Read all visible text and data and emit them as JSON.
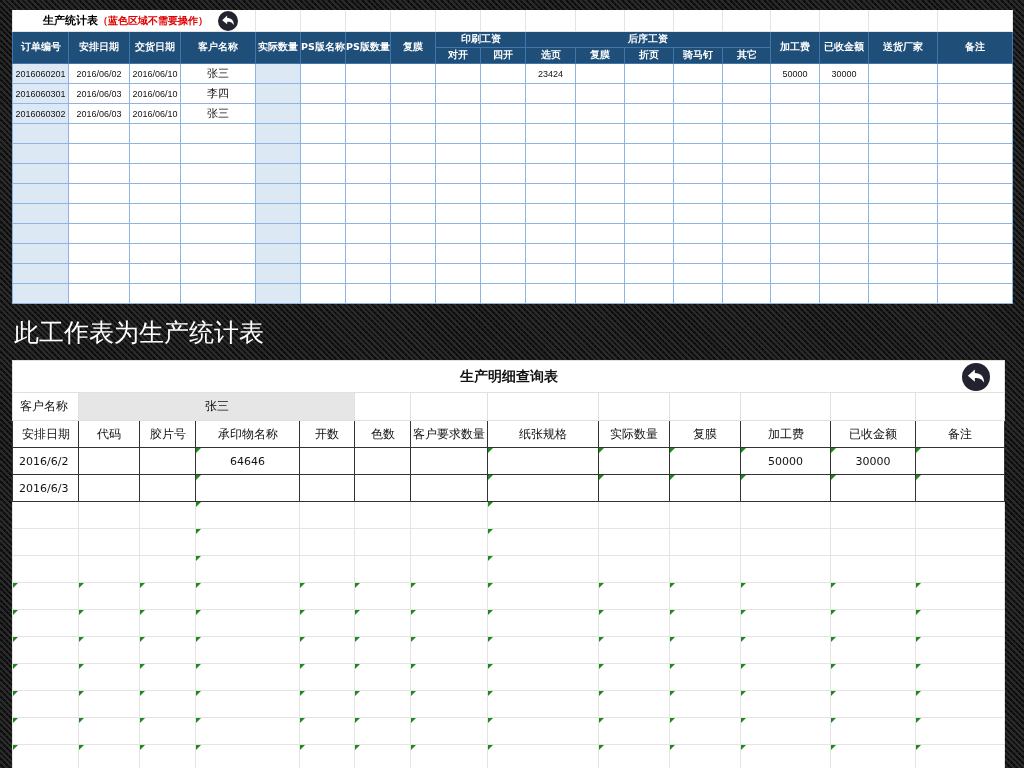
{
  "stats_sheet": {
    "title": "生产统计表",
    "note": "（蓝色区域不需要操作）",
    "headers": [
      {
        "label": "订单编号",
        "shaded": true
      },
      {
        "label": "安排日期",
        "shaded": false
      },
      {
        "label": "交货日期",
        "shaded": false
      },
      {
        "label": "客户名称",
        "shaded": false
      },
      {
        "label": "实际数量",
        "shaded": true
      },
      {
        "label": "PS版名称",
        "shaded": false
      },
      {
        "label": "PS版数量",
        "shaded": false
      },
      {
        "label": "复膜",
        "shaded": false
      },
      {
        "label": "印刷工资",
        "children": [
          {
            "label": "对开",
            "shaded": false
          },
          {
            "label": "四开",
            "shaded": false
          }
        ]
      },
      {
        "label": "后序工资",
        "children": [
          {
            "label": "选页",
            "shaded": false
          },
          {
            "label": "复膜",
            "shaded": false
          },
          {
            "label": "折页",
            "shaded": false
          },
          {
            "label": "骑马钉",
            "shaded": false
          },
          {
            "label": "其它",
            "shaded": false
          }
        ]
      },
      {
        "label": "加工费",
        "shaded": false
      },
      {
        "label": "已收金额",
        "shaded": false
      },
      {
        "label": "送货厂家",
        "shaded": false
      },
      {
        "label": "备注",
        "shaded": false
      }
    ],
    "rows": [
      [
        "2016060201",
        "2016/06/02",
        "2016/06/10",
        "张三",
        null,
        null,
        null,
        null,
        null,
        null,
        "23424",
        null,
        null,
        null,
        null,
        "50000",
        "30000",
        null,
        null
      ],
      [
        "2016060301",
        "2016/06/03",
        "2016/06/10",
        "李四",
        null,
        null,
        null,
        null,
        null,
        null,
        null,
        null,
        null,
        null,
        null,
        null,
        null,
        null,
        null
      ],
      [
        "2016060302",
        "2016/06/03",
        "2016/06/10",
        "张三",
        null,
        null,
        null,
        null,
        null,
        null,
        null,
        null,
        null,
        null,
        null,
        null,
        null,
        null,
        null
      ]
    ]
  },
  "caption": "此工作表为生产统计表",
  "detail_sheet": {
    "title": "生产明细查询表",
    "customer_label": "客户名称",
    "customer_value": "张三",
    "columns": [
      "安排日期",
      "代码",
      "胶片号",
      "承印物名称",
      "开数",
      "色数",
      "客户要求数量",
      "纸张规格",
      "实际数量",
      "复膜",
      "加工费",
      "已收金额",
      "备注"
    ],
    "rows": [
      {
        "cells": [
          "2016/6/2",
          null,
          null,
          "64646",
          null,
          null,
          null,
          null,
          null,
          null,
          "50000",
          "30000",
          null
        ],
        "flags": [
          false,
          false,
          false,
          true,
          false,
          false,
          false,
          true,
          true,
          true,
          true,
          true,
          true
        ]
      },
      {
        "cells": [
          "2016/6/3",
          null,
          null,
          null,
          null,
          null,
          null,
          null,
          null,
          null,
          null,
          null,
          null
        ],
        "flags": [
          false,
          false,
          false,
          true,
          false,
          false,
          false,
          true,
          true,
          true,
          true,
          true,
          true
        ]
      }
    ],
    "blank_rows": [
      {
        "flags": [
          false,
          false,
          false,
          true,
          false,
          false,
          false,
          true,
          false,
          false,
          false,
          false,
          false
        ]
      },
      {
        "flags": [
          false,
          false,
          false,
          true,
          false,
          false,
          false,
          true,
          false,
          false,
          false,
          false,
          false
        ]
      },
      {
        "flags": [
          false,
          false,
          false,
          true,
          false,
          false,
          false,
          true,
          false,
          false,
          false,
          false,
          false
        ]
      },
      {
        "flags": [
          true,
          true,
          true,
          true,
          true,
          true,
          true,
          true,
          true,
          true,
          true,
          true,
          true
        ]
      },
      {
        "flags": [
          true,
          true,
          true,
          true,
          true,
          true,
          true,
          true,
          true,
          true,
          true,
          true,
          true
        ]
      },
      {
        "flags": [
          true,
          true,
          true,
          true,
          true,
          true,
          true,
          true,
          true,
          true,
          true,
          true,
          true
        ]
      },
      {
        "flags": [
          true,
          true,
          true,
          true,
          true,
          true,
          true,
          true,
          true,
          true,
          true,
          true,
          true
        ]
      },
      {
        "flags": [
          true,
          true,
          true,
          true,
          true,
          true,
          true,
          true,
          true,
          true,
          true,
          true,
          true
        ]
      },
      {
        "flags": [
          true,
          true,
          true,
          true,
          true,
          true,
          true,
          true,
          true,
          true,
          true,
          true,
          true
        ]
      },
      {
        "flags": [
          true,
          true,
          true,
          true,
          true,
          true,
          true,
          true,
          true,
          true,
          true,
          true,
          true
        ]
      }
    ]
  }
}
